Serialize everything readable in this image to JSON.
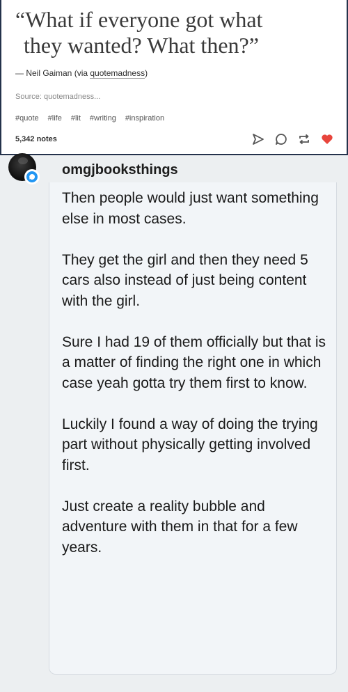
{
  "post": {
    "quote_line1": "“What if everyone got what",
    "quote_line2": "they wanted? What then?”",
    "attribution_prefix": "— Neil Gaiman (via ",
    "attribution_link": "quotemadness",
    "attribution_suffix": ")",
    "source": "Source: quotemadness...",
    "tags": [
      "#quote",
      "#life",
      "#lit",
      "#writing",
      "#inspiration"
    ],
    "notes": "5,342 notes",
    "colors": {
      "like": "#e8453c",
      "border": "#24324b"
    },
    "action_icons": [
      "send-icon",
      "comment-icon",
      "reblog-icon",
      "heart-icon"
    ]
  },
  "reply": {
    "username": "omgjbooksthings",
    "paragraphs": [
      "Then people would just want something else in most cases.",
      "They get the girl and then they need 5 cars also instead of just being content with the girl.",
      "Sure I had 19 of them officially but that is a matter of finding the right one in which case yeah gotta try them first to know.",
      "Luckily I found a way of doing the trying part without physically getting involved first.",
      "Just create a reality bubble and adventure with them in that for a few years."
    ],
    "badge_color": "#2196f3"
  }
}
